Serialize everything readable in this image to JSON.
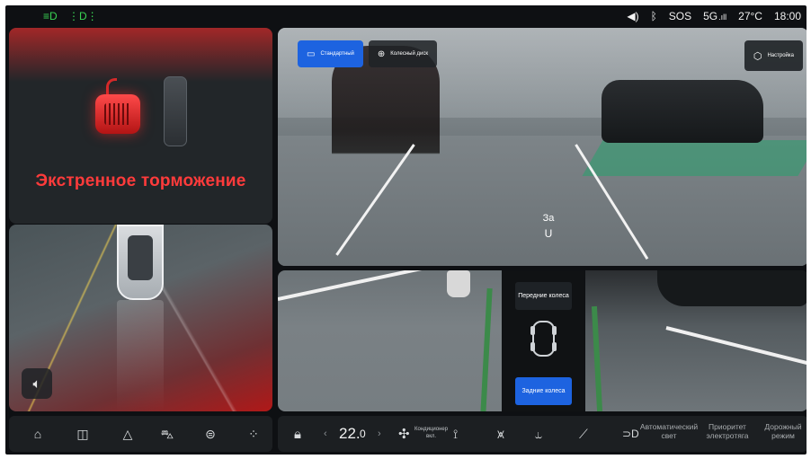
{
  "status_bar": {
    "headlight_icon": "headlight-icon",
    "parking_light_icon": "parking-light-icon",
    "volume_icon": "volume-icon",
    "bluetooth_icon": "bluetooth-icon",
    "sos": "SOS",
    "network": "5G",
    "temperature": "27°C",
    "time": "18:00"
  },
  "alert": {
    "message": "Экстренное торможение"
  },
  "camera": {
    "tabs": [
      {
        "label": "Стандартный",
        "icon": "camera-icon",
        "active": true
      },
      {
        "label": "Колесный диск",
        "icon": "wheel-icon",
        "active": false
      }
    ],
    "settings_label": "Настройка",
    "gear": "За"
  },
  "wheel_selector": {
    "front_label": "Передние колеса",
    "rear_label": "Задние колеса",
    "selected": "rear"
  },
  "dock": {
    "temperature_value": "22.",
    "temperature_unit": "0",
    "ac_label_line1": "Кондиционер",
    "ac_label_line2": "вкл.",
    "auto_light_line1": "Автоматический",
    "auto_light_line2": "свет",
    "priority_line1": "Приоритет",
    "priority_line2": "электротяга",
    "road_line1": "Дорожный",
    "road_line2": "режим"
  },
  "colors": {
    "accent": "#1d63e0",
    "alert": "#ff3b3b",
    "status_green": "#39d353",
    "background": "#0e1013"
  }
}
